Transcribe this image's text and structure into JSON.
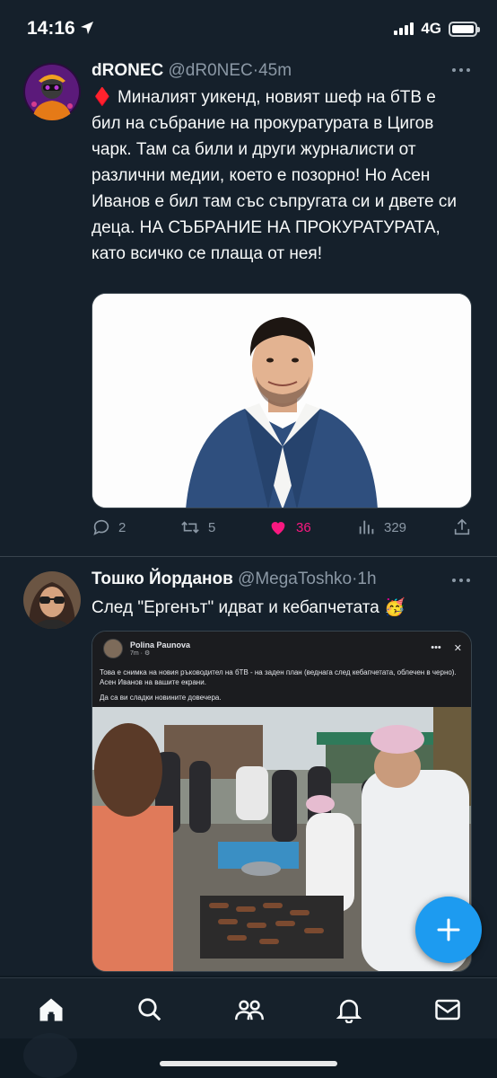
{
  "status_bar": {
    "time": "14:16",
    "network": "4G"
  },
  "tweets": [
    {
      "name": "dRONEC",
      "handle": "@dR0NEC",
      "separator": "·",
      "time": "45m",
      "text_emoji": "♦️",
      "text": "Миналият уикенд, новият шеф на бТВ е бил на събрание на прокуратурата в Цигов чарк. Там са били и други журналисти от различни медии, което е позорно! Но Асен Иванов е бил там със съпругата си и двете си деца. НА СЪБРАНИЕ НА ПРОКУРАТУРАТА, като всичко се плаща от нея!",
      "stats": {
        "replies": "2",
        "retweets": "5",
        "likes": "36",
        "views": "329"
      },
      "liked": true
    },
    {
      "name": "Тошко Йорданов",
      "handle": "@MegaToshko",
      "separator": "·",
      "time": "1h",
      "text": "След \"Ергенът\" идват и кебапчетата",
      "text_emoji": "🥳",
      "embedded_post": {
        "author": "Polina Paunova",
        "time": "7m · ⚙",
        "text": "Това е снимка на новия ръководител на бТВ - на заден план (веднага след кебапчетата, облечен в черно).  Асен Иванов на вашите екрани.",
        "text2": "Да са ви сладки новините довечера."
      }
    }
  ],
  "colors": {
    "background": "#15202b",
    "accent": "#1d9bf0",
    "like": "#f91880",
    "muted": "#8b98a5"
  },
  "icons": [
    "navigation-arrow-icon",
    "more-icon",
    "reply-icon",
    "retweet-icon",
    "heart-icon",
    "views-icon",
    "share-icon",
    "compose-plus-icon",
    "home-icon",
    "search-icon",
    "communities-icon",
    "notifications-icon",
    "messages-icon"
  ]
}
